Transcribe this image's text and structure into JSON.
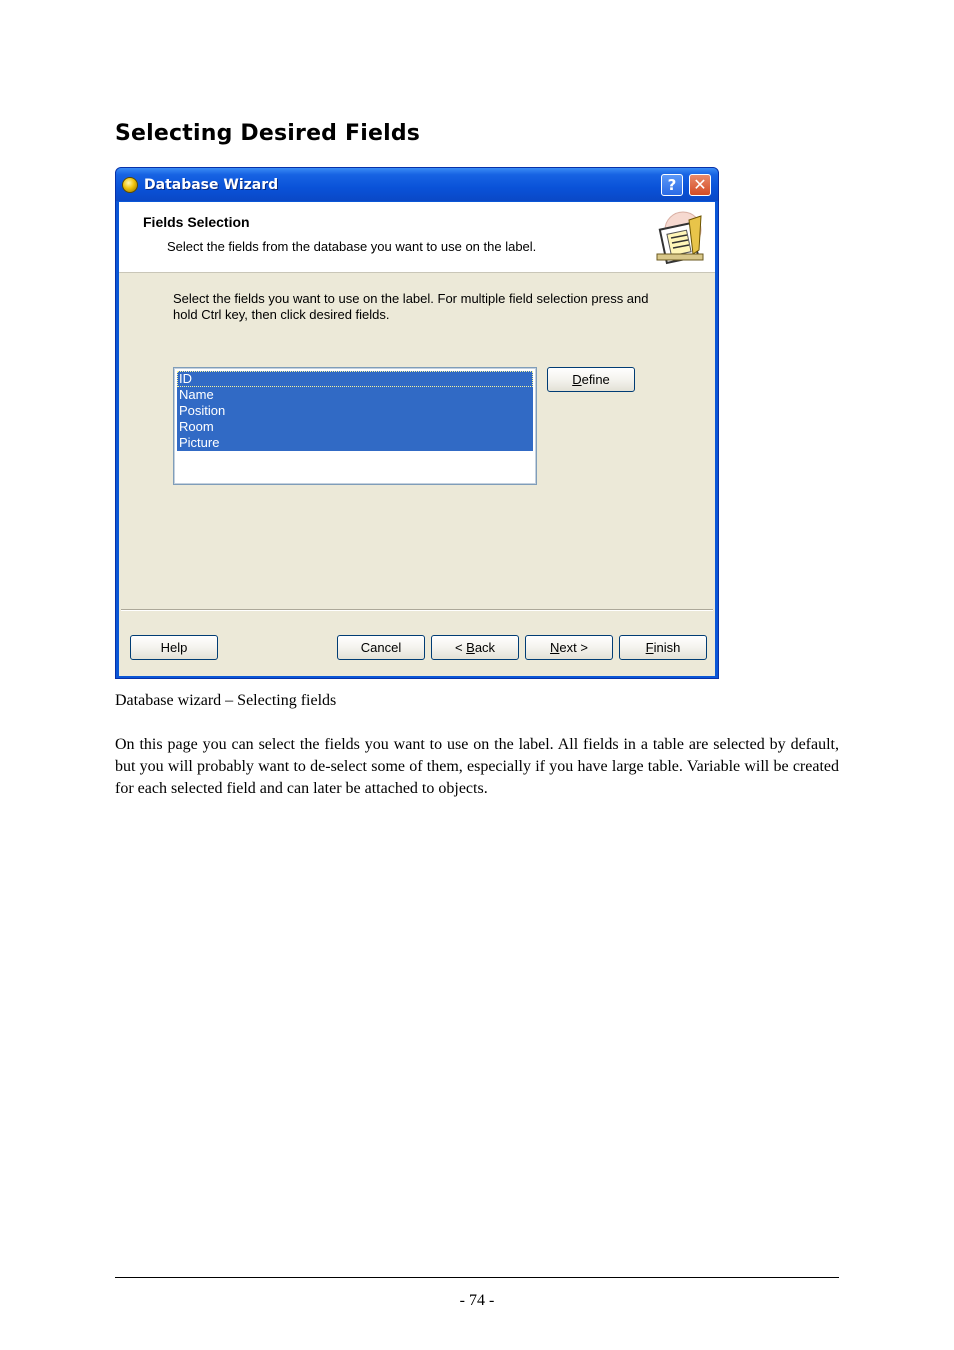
{
  "heading": "Selecting Desired Fields",
  "window": {
    "title": "Database Wizard",
    "help_glyph": "?",
    "close_glyph": "✕",
    "header": {
      "title": "Fields Selection",
      "subtitle": "Select the fields from the database you want to use on the label."
    },
    "instruction_line1": "Select the fields you want to use on the label. For multiple field selection press and",
    "instruction_line2": "hold Ctrl key, then click desired fields.",
    "fields": [
      "ID",
      "Name",
      "Position",
      "Room",
      "Picture"
    ],
    "buttons": {
      "define": {
        "pre": "",
        "u": "D",
        "post": "efine"
      },
      "help": "Help",
      "cancel": "Cancel",
      "back": {
        "pre": "< ",
        "u": "B",
        "post": "ack"
      },
      "next": {
        "pre": "",
        "u": "N",
        "post": "ext >"
      },
      "finish": {
        "pre": "",
        "u": "F",
        "post": "inish"
      }
    },
    "colors": {
      "selection": "#316ac5",
      "titlebar": "#0a52d8",
      "client": "#ece9d8"
    }
  },
  "caption": "Database wizard – Selecting fields",
  "paragraph": "On this page you can select the fields you want to use on the label. All fields in a table are selected by default, but you will probably want to de-select some of them, especially if you have large table. Variable will be created for each selected field and can later be attached to objects.",
  "page_number": "- 74 -"
}
